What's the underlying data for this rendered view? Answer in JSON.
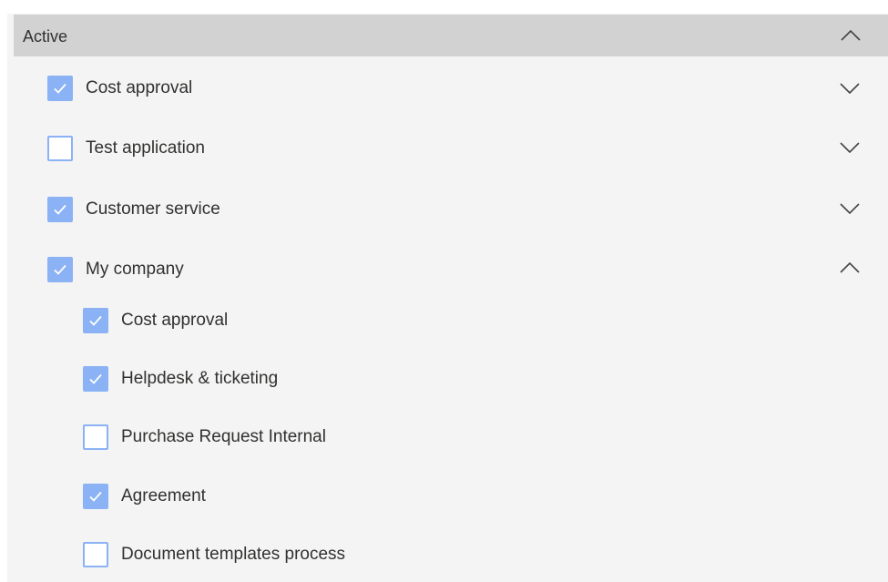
{
  "section": {
    "title": "Active",
    "expanded": true
  },
  "groups": [
    {
      "label": "Cost approval",
      "checked": true,
      "expanded": false
    },
    {
      "label": "Test application",
      "checked": false,
      "expanded": false
    },
    {
      "label": "Customer service",
      "checked": true,
      "expanded": false
    },
    {
      "label": "My company",
      "checked": true,
      "expanded": true
    }
  ],
  "subitems": [
    {
      "label": "Cost approval",
      "checked": true
    },
    {
      "label": "Helpdesk & ticketing",
      "checked": true
    },
    {
      "label": "Purchase Request Internal",
      "checked": false
    },
    {
      "label": "Agreement",
      "checked": true
    },
    {
      "label": "Document templates process",
      "checked": false
    }
  ],
  "icons": {
    "collapse": "chevron-up-icon",
    "expand": "chevron-down-icon",
    "check": "checkmark-icon"
  },
  "colors": {
    "accent": "#8bb2f5",
    "header_bg": "#d2d2d2",
    "panel_bg": "#f4f4f4"
  }
}
